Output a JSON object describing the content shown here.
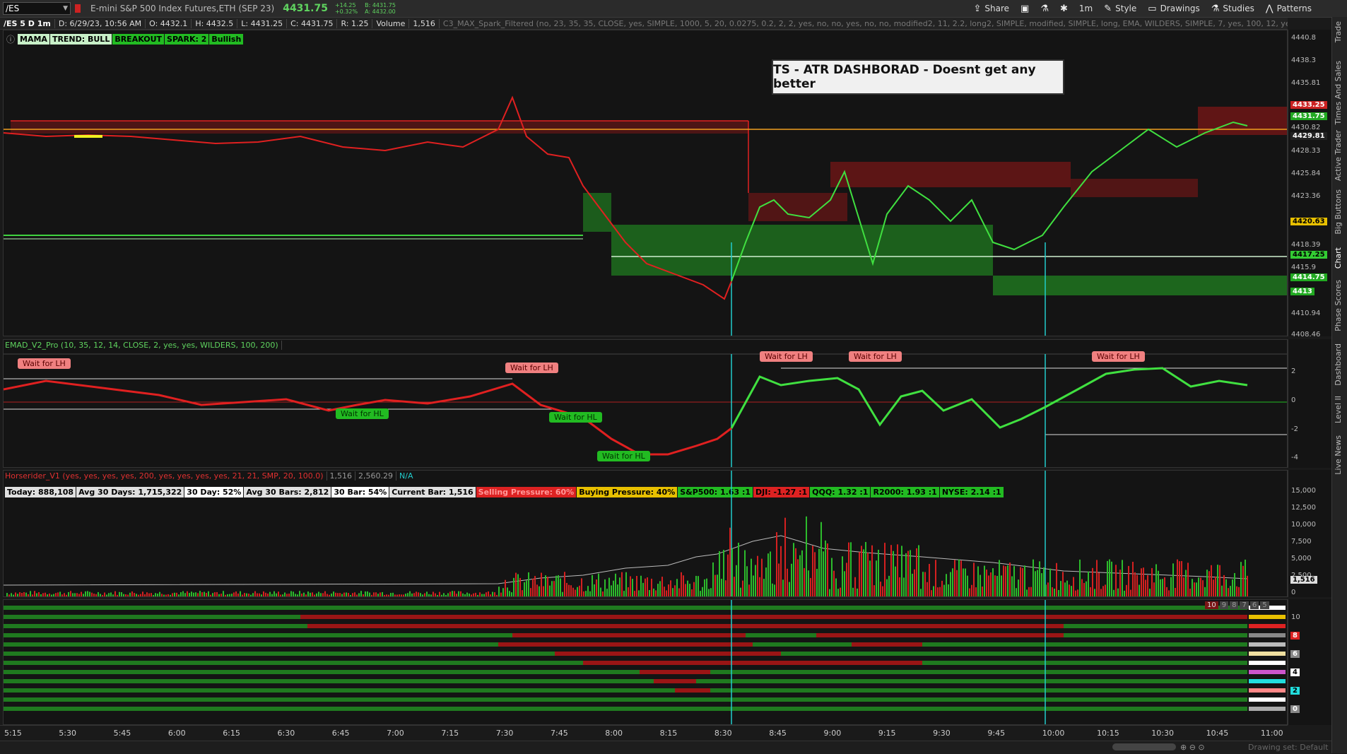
{
  "topbar": {
    "symbol": "/ES",
    "description": "E-mini S&P 500 Index Futures,ETH (SEP 23)",
    "last_price": "4431.75",
    "change": "+14.25",
    "change_pct": "+0.32%",
    "bid": "B: 4431.75",
    "ask": "A: 4432.00",
    "buttons": {
      "share": "Share",
      "interval": "1m",
      "style": "Style",
      "drawings": "Drawings",
      "studies": "Studies",
      "patterns": "Patterns"
    }
  },
  "statusbar": {
    "symbol_interval": "/ES 5 D 1m",
    "date": "D: 6/29/23, 10:56 AM",
    "open": "O: 4432.1",
    "high": "H: 4432.5",
    "low": "L: 4431.25",
    "close": "C: 4431.75",
    "range": "R: 1.25",
    "volume_label": "Volume",
    "volume_value": "1,516",
    "study": "C3_MAX_Spark_Filtered (no, 23, 35, 35, CLOSE, yes, SIMPLE, 1000, 5, 20, 0.0275, 0.2, 2, 2, yes, no, no, yes, no, no, modified2, 11, 2.2, long2, SIMPLE, modified, SIMPLE, long, EMA, WILDERS, SIMPLE, 7, yes, 100, 12, yes, 10, no, 14, WILDERS, yes, 10,..."
  },
  "badges": [
    "MAMA",
    "TREND: BULL",
    "BREAKOUT",
    "SPARK: 2",
    "Bullish"
  ],
  "banner": "TS - ATR DASHBORAD - Doesnt get any better",
  "price_axis": {
    "labels": [
      "4440.8",
      "4438.3",
      "4435.81",
      "4433.25",
      "4430.82",
      "4428.33",
      "4425.84",
      "4423.36",
      "4418.39",
      "4415.9",
      "4410.94",
      "4408.46"
    ],
    "tags": [
      {
        "text": "4433.25",
        "bg": "#cc2222",
        "fg": "#ffffff"
      },
      {
        "text": "4431.75",
        "bg": "#22aa22",
        "fg": "#ffffff"
      },
      {
        "text": "4429.81",
        "bg": "#222222",
        "fg": "#ffffff"
      },
      {
        "text": "4420.63",
        "bg": "#e8c000",
        "fg": "#000000"
      },
      {
        "text": "4417.25",
        "bg": "#33cc33",
        "fg": "#000000"
      },
      {
        "text": "4414.75",
        "bg": "#22aa22",
        "fg": "#ffffff"
      },
      {
        "text": "4413",
        "bg": "#22aa22",
        "fg": "#ffffff"
      }
    ]
  },
  "emad": {
    "header": "EMAD_V2_Pro (10, 35, 12, 14, CLOSE, 2, yes, yes, WILDERS, 100, 200)",
    "axis": [
      "2",
      "0",
      "-2",
      "-4"
    ],
    "pills": [
      {
        "text": "Wait for LH",
        "kind": "lh"
      },
      {
        "text": "Wait for LH",
        "kind": "lh"
      },
      {
        "text": "Wait for HL",
        "kind": "hl"
      },
      {
        "text": "Wait for HL",
        "kind": "hl"
      },
      {
        "text": "Wait for HL",
        "kind": "hl"
      },
      {
        "text": "Wait for LH",
        "kind": "lh"
      },
      {
        "text": "Wait for LH",
        "kind": "lh"
      },
      {
        "text": "Wait for LH",
        "kind": "lh"
      }
    ]
  },
  "volume": {
    "header": "Horserider_V1 (yes, yes, yes, yes, 200, yes, yes, yes, yes, 21, 21, SMP, 20, 100.0)",
    "header_v1": "1,516",
    "header_v2": "2,560.29",
    "header_na": "N/A",
    "stats": [
      {
        "text": "Today: 888,108",
        "bg": "#e0e0e0",
        "fg": "#000"
      },
      {
        "text": "Avg 30 Days: 1,715,322",
        "bg": "#e0e0e0",
        "fg": "#000"
      },
      {
        "text": "30 Day: 52%",
        "bg": "#ffffff",
        "fg": "#000"
      },
      {
        "text": "Avg 30 Bars: 2,812",
        "bg": "#e0e0e0",
        "fg": "#000"
      },
      {
        "text": "30 Bar: 54%",
        "bg": "#ffffff",
        "fg": "#000"
      },
      {
        "text": "Current Bar: 1,516",
        "bg": "#e0e0e0",
        "fg": "#000"
      },
      {
        "text": "Selling Pressure: 60%",
        "bg": "#dd2222",
        "fg": "#ff9a9a"
      },
      {
        "text": "Buying Pressure: 40%",
        "bg": "#e8c000",
        "fg": "#000"
      },
      {
        "text": "S&P500: 1.63 :1",
        "bg": "#22bb22",
        "fg": "#000"
      },
      {
        "text": "DJI: -1.27 :1",
        "bg": "#dd2222",
        "fg": "#000"
      },
      {
        "text": "QQQ: 1.32 :1",
        "bg": "#22bb22",
        "fg": "#000"
      },
      {
        "text": "R2000: 1.93 :1",
        "bg": "#22bb22",
        "fg": "#000"
      },
      {
        "text": "NYSE: 2.14 :1",
        "bg": "#22bb22",
        "fg": "#000"
      }
    ],
    "axis": [
      "15,000",
      "12,500",
      "10,000",
      "7,500",
      "5,000",
      "2,500",
      "0"
    ],
    "current": "1,516"
  },
  "dashboard": {
    "axis": [
      "10",
      "8",
      "6",
      "4",
      "2",
      "0"
    ],
    "axis_colors": [
      "#141414",
      "#dd2222",
      "#888888",
      "#ffffff",
      "#22dddd",
      "#888888"
    ],
    "legend_nums": [
      "10",
      "9",
      "8",
      "7",
      "6",
      "5"
    ]
  },
  "time_axis": [
    "5:15",
    "5:30",
    "5:45",
    "6:00",
    "6:15",
    "6:30",
    "6:45",
    "7:00",
    "7:15",
    "7:30",
    "7:45",
    "8:00",
    "8:15",
    "8:30",
    "8:45",
    "9:00",
    "9:15",
    "9:30",
    "9:45",
    "10:00",
    "10:15",
    "10:30",
    "10:45",
    "11:00"
  ],
  "footer": "Drawing set: Default",
  "right_tabs": [
    "Trade",
    "Times And Sales",
    "Active Trader",
    "Big Buttons",
    "Chart",
    "Phase Scores",
    "Dashboard",
    "Level II",
    "Live News"
  ]
}
